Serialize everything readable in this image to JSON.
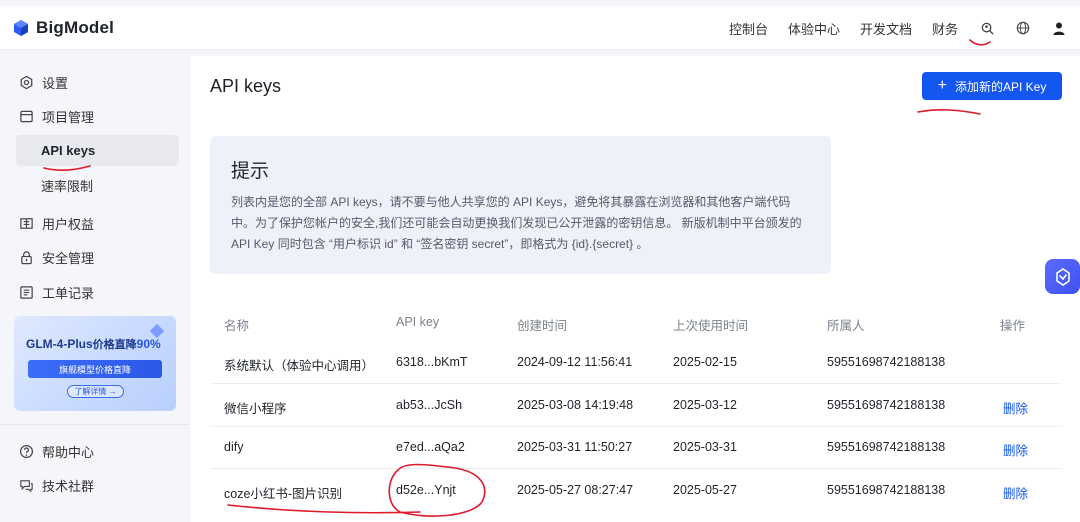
{
  "app": {
    "brand": "BigModel"
  },
  "top_nav": {
    "items": [
      "控制台",
      "体验中心",
      "开发文档",
      "财务"
    ],
    "icons": [
      "user-search-icon",
      "globe-icon",
      "user-icon"
    ]
  },
  "sidebar": {
    "items": [
      {
        "label": "设置",
        "icon": "settings-icon"
      },
      {
        "label": "项目管理",
        "icon": "project-icon"
      },
      {
        "label": "API keys",
        "active": true
      },
      {
        "label": "速率限制"
      },
      {
        "label": "用户权益",
        "icon": "benefits-icon"
      },
      {
        "label": "安全管理",
        "icon": "lock-icon"
      },
      {
        "label": "工单记录",
        "icon": "ticket-icon"
      }
    ],
    "promo": {
      "title_prefix": "GLM-4-Plus",
      "title_suffix": "价格直降",
      "title_percent": "90%",
      "band": "旗舰模型价格直降",
      "button": "了解详情 →"
    },
    "bottom_items": [
      {
        "label": "帮助中心",
        "icon": "help-icon"
      },
      {
        "label": "技术社群",
        "icon": "community-icon"
      }
    ]
  },
  "main": {
    "title": "API keys",
    "add_button": "添加新的API Key",
    "tip": {
      "title": "提示",
      "body": "列表内是您的全部 API keys，请不要与他人共享您的 API Keys，避免将其暴露在浏览器和其他客户端代码中。为了保护您帐户的安全,我们还可能会自动更换我们发现已公开泄露的密钥信息。 新版机制中平台颁发的 API Key 同时包含 “用户标识 id” 和 “签名密钥 secret”，即格式为 {id}.{secret} 。"
    },
    "table": {
      "columns": [
        "名称",
        "API key",
        "创建时间",
        "上次使用时间",
        "所属人",
        "操作"
      ],
      "rows": [
        {
          "name": "系统默认（体验中心调用）",
          "key": "6318...bKmT",
          "created": "2024-09-12 11:56:41",
          "last_used": "2025-02-15",
          "owner": "59551698742188138",
          "action": ""
        },
        {
          "name": "微信小程序",
          "key": "ab53...JcSh",
          "created": "2025-03-08 14:19:48",
          "last_used": "2025-03-12",
          "owner": "59551698742188138",
          "action": "删除"
        },
        {
          "name": "dify",
          "key": "e7ed...aQa2",
          "created": "2025-03-31 11:50:27",
          "last_used": "2025-03-31",
          "owner": "59551698742188138",
          "action": "删除"
        },
        {
          "name": "coze小红书-图片识别",
          "key": "d52e...Ynjt",
          "created": "2025-05-27 08:27:47",
          "last_used": "2025-05-27",
          "owner": "59551698742188138",
          "action": "删除"
        }
      ]
    }
  },
  "colors": {
    "accent": "#1456f0",
    "annotation": "#e0192b"
  }
}
